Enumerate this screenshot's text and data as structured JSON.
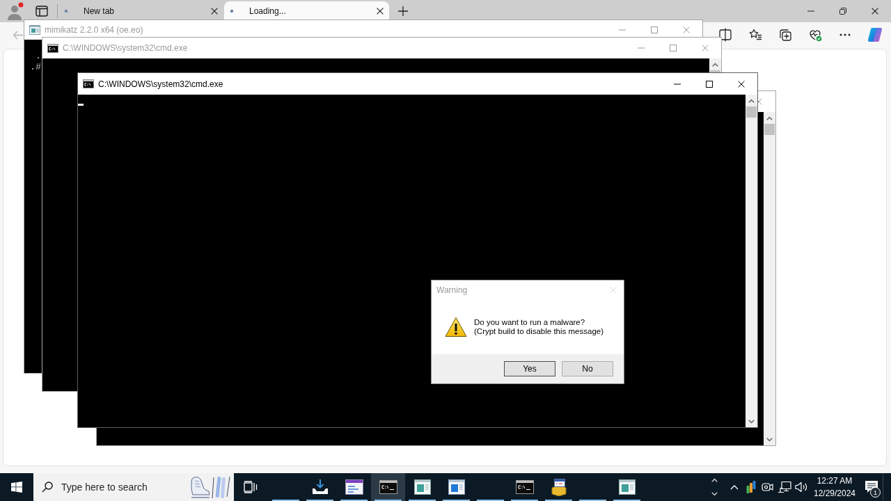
{
  "browser": {
    "tabs": [
      {
        "title": "New tab",
        "selected": false
      },
      {
        "title": "Loading...",
        "selected": true
      }
    ]
  },
  "windows": [
    {
      "kind": "program",
      "title": "mimikatz 2.2.0 x64 (oe.eo)",
      "active": false,
      "cursor": false,
      "lines": [
        "  .",
        " .#"
      ]
    },
    {
      "kind": "console",
      "title": "C:\\WINDOWS\\system32\\cmd.exe",
      "active": false,
      "cursor": false
    },
    {
      "active": false
    },
    {
      "kind": "console",
      "title": "C:\\WINDOWS\\system32\\cmd.exe",
      "active": true,
      "cursor": true
    }
  ],
  "dialog": {
    "title": "Warning",
    "message": "Do you want to run a malware?\n(Crypt build to disable this message)",
    "buttons": [
      {
        "label": "Yes",
        "default": true
      },
      {
        "label": "No",
        "default": false
      }
    ]
  },
  "taskbar": {
    "search": {
      "placeholder": "Type here to search"
    },
    "apps": [
      {
        "kind": "blank",
        "selected": false
      },
      {
        "kind": "download",
        "selected": false
      },
      {
        "kind": "form",
        "selected": false
      },
      {
        "kind": "console",
        "selected": true
      },
      {
        "kind": "panel",
        "selected": false
      },
      {
        "kind": "window",
        "selected": false
      },
      {
        "kind": "blank",
        "selected": false
      },
      {
        "kind": "console",
        "selected": false
      },
      {
        "kind": "installer",
        "selected": false
      },
      {
        "kind": "blank",
        "selected": false
      },
      {
        "kind": "panel",
        "selected": false
      }
    ],
    "clock": {
      "time": "12:27 AM",
      "date": "12/29/2024"
    },
    "notification_count": "1"
  }
}
